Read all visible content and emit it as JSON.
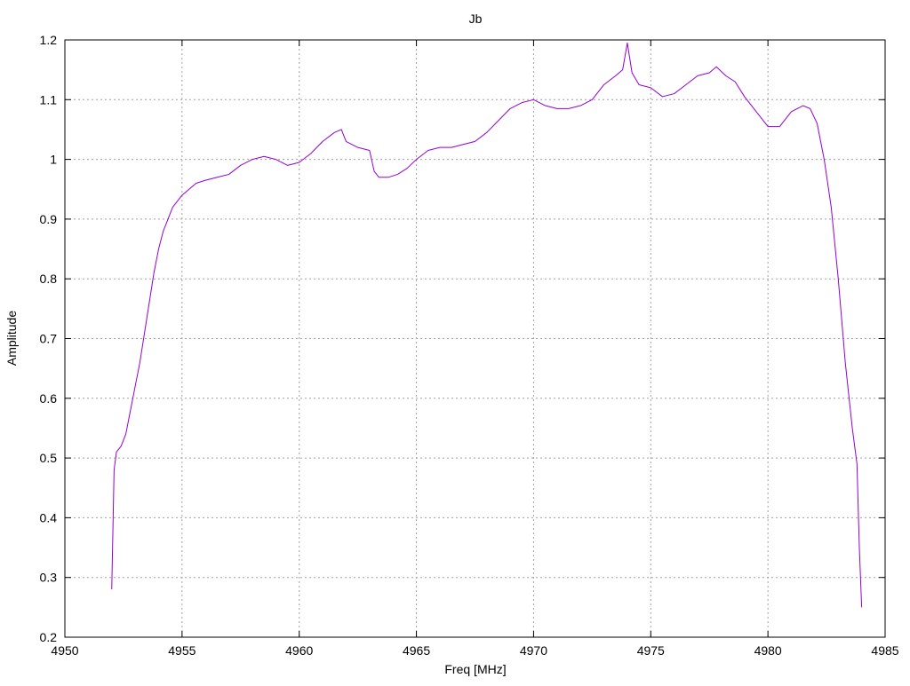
{
  "chart_data": {
    "type": "line",
    "title": "Jb",
    "xlabel": "Freq [MHz]",
    "ylabel": "Amplitude",
    "xlim": [
      4950,
      4985
    ],
    "ylim": [
      0.2,
      1.2
    ],
    "grid": true,
    "xticks": [
      "4950",
      "4955",
      "4960",
      "4965",
      "4970",
      "4975",
      "4980",
      "4985"
    ],
    "yticks": [
      "0.2",
      "0.3",
      "0.4",
      "0.5",
      "0.6",
      "0.7",
      "0.8",
      "0.9",
      "1",
      "1.1",
      "1.2"
    ],
    "colors": {
      "line": "#9400d3",
      "grid": "#a0a0a0",
      "frame": "#000000"
    },
    "series": [
      {
        "x": [
          4952.0,
          4952.1,
          4952.2,
          4952.4,
          4952.6,
          4952.8,
          4953.0,
          4953.2,
          4953.4,
          4953.6,
          4953.8,
          4954.0,
          4954.2,
          4954.4,
          4954.6,
          4954.8,
          4955.0,
          4955.3,
          4955.6,
          4956.0,
          4956.5,
          4957.0,
          4957.5,
          4958.0,
          4958.5,
          4959.0,
          4959.5,
          4960.0,
          4960.5,
          4961.0,
          4961.5,
          4961.8,
          4962.0,
          4962.5,
          4963.0,
          4963.2,
          4963.4,
          4963.8,
          4964.2,
          4964.6,
          4965.0,
          4965.5,
          4966.0,
          4966.5,
          4967.0,
          4967.5,
          4968.0,
          4968.5,
          4969.0,
          4969.5,
          4970.0,
          4970.5,
          4971.0,
          4971.5,
          4972.0,
          4972.5,
          4973.0,
          4973.5,
          4973.8,
          4974.0,
          4974.2,
          4974.5,
          4975.0,
          4975.5,
          4976.0,
          4976.5,
          4977.0,
          4977.5,
          4977.8,
          4978.2,
          4978.6,
          4979.0,
          4979.5,
          4980.0,
          4980.5,
          4981.0,
          4981.5,
          4981.8,
          4982.1,
          4982.4,
          4982.7,
          4983.0,
          4983.3,
          4983.6,
          4983.8,
          4983.9,
          4984.0
        ],
        "y": [
          0.28,
          0.48,
          0.51,
          0.52,
          0.54,
          0.58,
          0.62,
          0.66,
          0.71,
          0.76,
          0.81,
          0.85,
          0.88,
          0.9,
          0.92,
          0.93,
          0.94,
          0.95,
          0.96,
          0.965,
          0.97,
          0.975,
          0.99,
          1.0,
          1.005,
          1.0,
          0.99,
          0.995,
          1.01,
          1.03,
          1.045,
          1.05,
          1.03,
          1.02,
          1.015,
          0.98,
          0.97,
          0.97,
          0.975,
          0.985,
          1.0,
          1.015,
          1.02,
          1.02,
          1.025,
          1.03,
          1.045,
          1.065,
          1.085,
          1.095,
          1.1,
          1.09,
          1.085,
          1.085,
          1.09,
          1.1,
          1.125,
          1.14,
          1.15,
          1.195,
          1.145,
          1.125,
          1.12,
          1.105,
          1.11,
          1.125,
          1.14,
          1.145,
          1.155,
          1.14,
          1.13,
          1.105,
          1.08,
          1.055,
          1.055,
          1.08,
          1.09,
          1.085,
          1.06,
          1.0,
          0.92,
          0.8,
          0.66,
          0.55,
          0.49,
          0.35,
          0.25
        ]
      }
    ]
  }
}
